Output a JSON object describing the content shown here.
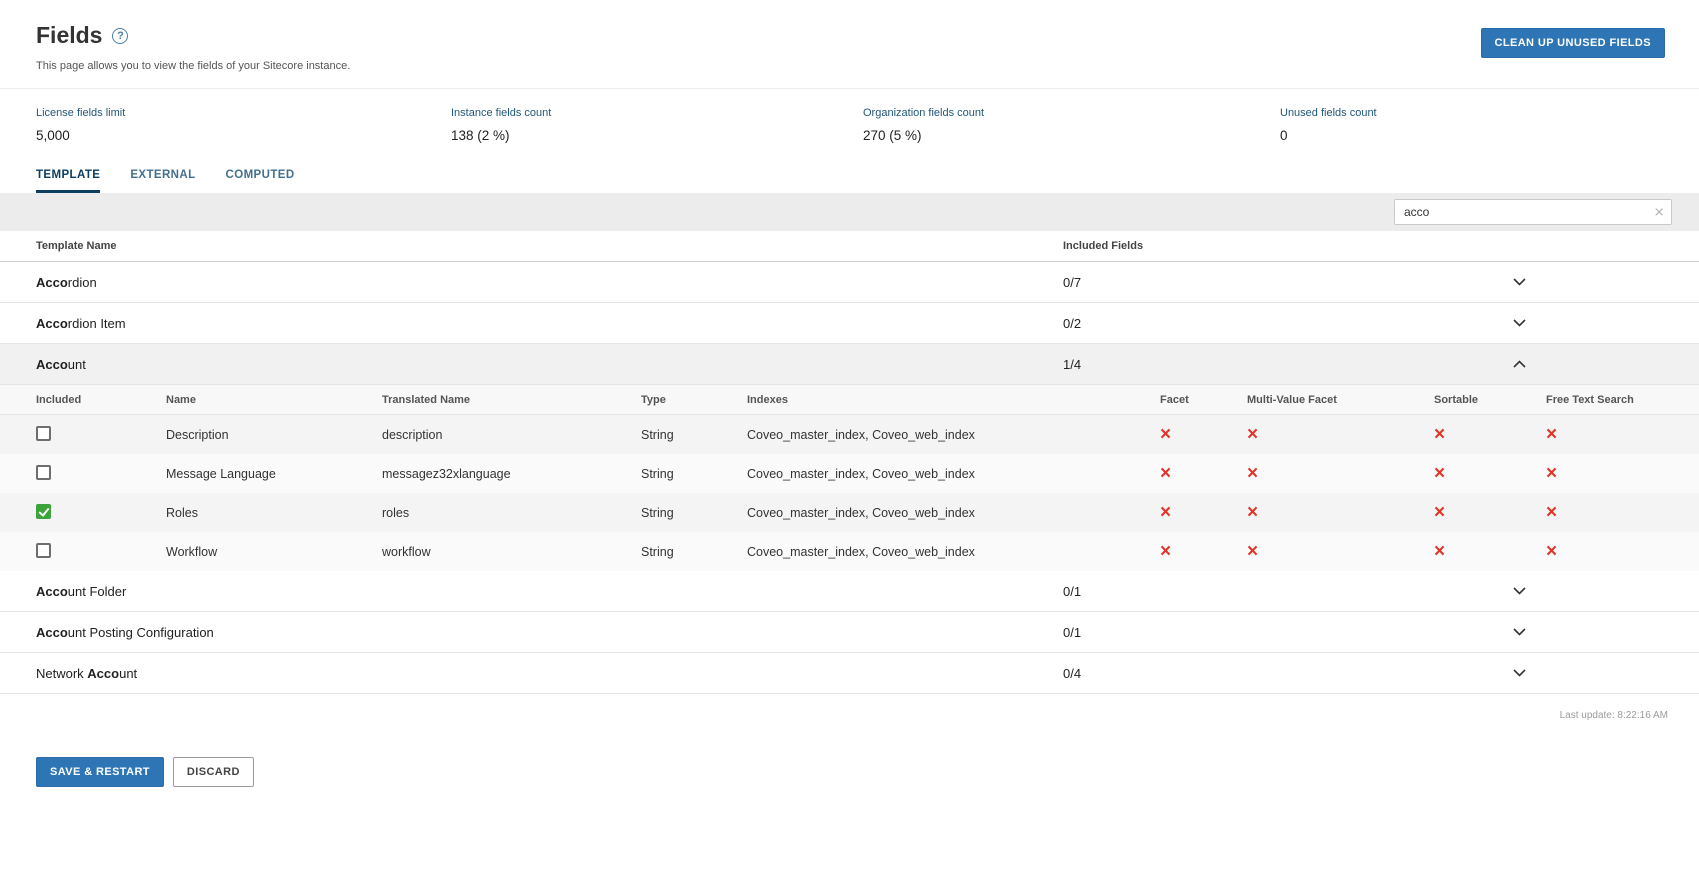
{
  "header": {
    "title": "Fields",
    "help_icon": "?",
    "subtitle": "This page allows you to view the fields of your Sitecore instance.",
    "cleanup_button": "CLEAN UP UNUSED FIELDS"
  },
  "stats": [
    {
      "label": "License fields limit",
      "value": "5,000"
    },
    {
      "label": "Instance fields count",
      "value": "138 (2 %)"
    },
    {
      "label": "Organization fields count",
      "value": "270 (5 %)"
    },
    {
      "label": "Unused fields count",
      "value": "0"
    }
  ],
  "tabs": [
    {
      "label": "TEMPLATE",
      "active": "true"
    },
    {
      "label": "EXTERNAL",
      "active": "false"
    },
    {
      "label": "COMPUTED",
      "active": "false"
    }
  ],
  "search": {
    "value": "acco",
    "clear_icon": "×"
  },
  "table": {
    "headers": {
      "template_name": "Template Name",
      "included_fields": "Included Fields"
    },
    "rows": [
      {
        "pre": "",
        "match": "Acco",
        "rest": "rdion",
        "count": "0/7",
        "expanded": "false"
      },
      {
        "pre": "",
        "match": "Acco",
        "rest": "rdion Item",
        "count": "0/2",
        "expanded": "false"
      },
      {
        "pre": "",
        "match": "Acco",
        "rest": "unt",
        "count": "1/4",
        "expanded": "true"
      },
      {
        "pre": "",
        "match": "Acco",
        "rest": "unt Folder",
        "count": "0/1",
        "expanded": "false"
      },
      {
        "pre": "",
        "match": "Acco",
        "rest": "unt Posting Configuration",
        "count": "0/1",
        "expanded": "false"
      },
      {
        "pre": "Network ",
        "match": "Acco",
        "rest": "unt",
        "count": "0/4",
        "expanded": "false"
      }
    ]
  },
  "subtable": {
    "headers": [
      "Included",
      "Name",
      "Translated Name",
      "Type",
      "Indexes",
      "Facet",
      "Multi-Value Facet",
      "Sortable",
      "Free Text Search"
    ],
    "x_icon": "×",
    "check_icon": "✓",
    "rows": [
      {
        "included": "false",
        "name": "Description",
        "translated_name": "description",
        "type": "String",
        "indexes": "Coveo_master_index, Coveo_web_index"
      },
      {
        "included": "false",
        "name": "Message Language",
        "translated_name": "messagez32xlanguage",
        "type": "String",
        "indexes": "Coveo_master_index, Coveo_web_index"
      },
      {
        "included": "true",
        "name": "Roles",
        "translated_name": "roles",
        "type": "String",
        "indexes": "Coveo_master_index, Coveo_web_index"
      },
      {
        "included": "false",
        "name": "Workflow",
        "translated_name": "workflow",
        "type": "String",
        "indexes": "Coveo_master_index, Coveo_web_index"
      }
    ]
  },
  "footer": {
    "last_update": "Last update: 8:22:16 AM",
    "save_button": "SAVE & RESTART",
    "discard_button": "DISCARD"
  },
  "colors": {
    "primary_blue": "#2e75b6",
    "tab_active": "#0d3d61",
    "error_red": "#e0352b",
    "checked_green": "#3aa33a",
    "toolbar_gray": "#ececec"
  }
}
